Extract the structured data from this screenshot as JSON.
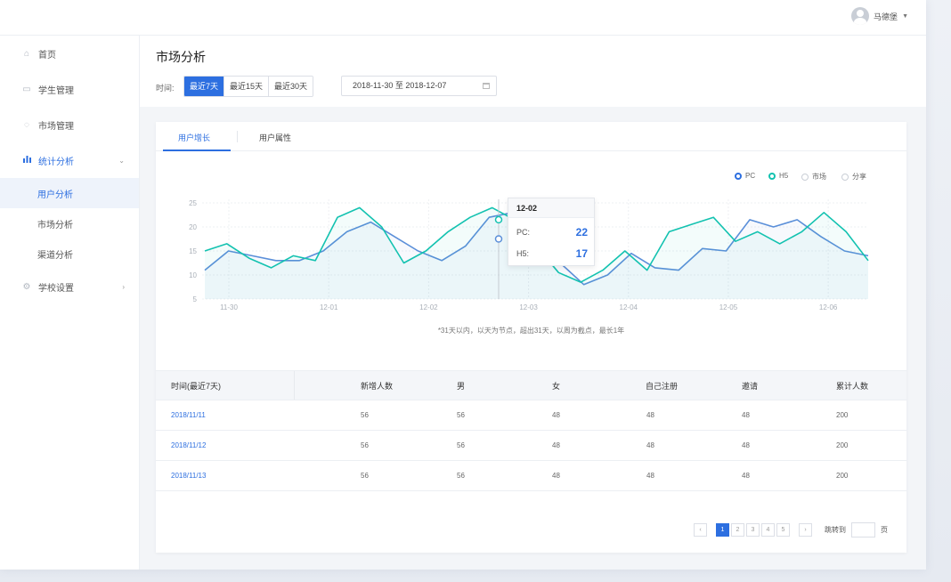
{
  "topbar": {
    "user_name": "马德堡"
  },
  "sidebar": {
    "items": [
      {
        "label": "首页",
        "icon": "home-icon"
      },
      {
        "label": "学生管理",
        "icon": "list-icon"
      },
      {
        "label": "市场管理",
        "icon": "tag-icon"
      },
      {
        "label": "统计分析",
        "icon": "bar-chart-icon"
      },
      {
        "label": "学校设置",
        "icon": "gear-icon"
      }
    ],
    "sub_items": [
      {
        "label": "用户分析"
      },
      {
        "label": "市场分析"
      },
      {
        "label": "渠道分析"
      }
    ]
  },
  "page": {
    "title": "市场分析",
    "time_label": "时间:",
    "ranges": [
      "最近7天",
      "最近15天",
      "最近30天"
    ],
    "date_range": "2018-11-30 至 2018-12-07"
  },
  "tabs": [
    "用户增长",
    "用户属性"
  ],
  "legend": [
    {
      "label": "PC",
      "color": "#2d6fe0",
      "on": true
    },
    {
      "label": "H5",
      "color": "#13c2b0",
      "on": true
    },
    {
      "label": "市场",
      "on": false
    },
    {
      "label": "分享",
      "on": false
    }
  ],
  "chart_data": {
    "type": "line",
    "x_ticks": [
      "11-30",
      "12-01",
      "12-02",
      "12-03",
      "12-04",
      "12-05",
      "12-06"
    ],
    "y_ticks": [
      5,
      10,
      15,
      20,
      25
    ],
    "ylim": [
      5,
      25
    ],
    "grid": true,
    "x": [
      0,
      0.25,
      0.5,
      0.75,
      1.0,
      1.25,
      1.5,
      1.75,
      2.0,
      2.25,
      2.5,
      2.75,
      3.0,
      3.25,
      3.5,
      3.75,
      4.0,
      4.25,
      4.5,
      4.75,
      5.0,
      5.25,
      5.5,
      5.75,
      6.0,
      6.25
    ],
    "series": [
      {
        "name": "PC",
        "color": "#5b8fd9",
        "values": [
          11,
          15,
          14,
          13,
          13,
          15,
          19,
          21,
          18,
          15,
          13,
          16,
          22,
          23,
          17.5,
          12.5,
          8,
          10,
          14.5,
          11.5,
          11,
          15.5,
          15,
          21.5,
          20,
          21.5,
          18,
          15,
          14
        ]
      },
      {
        "name": "H5",
        "color": "#13c2b0",
        "values": [
          15,
          16.5,
          13.5,
          11.5,
          14,
          13,
          22,
          24,
          20,
          12.5,
          15,
          19,
          22,
          24,
          21.5,
          16,
          10.5,
          8.5,
          11,
          15,
          11,
          19,
          20.5,
          22,
          17,
          19,
          16.5,
          19,
          23,
          19,
          13
        ]
      }
    ],
    "tooltip": {
      "label": "12-02",
      "rows": [
        {
          "name": "PC:",
          "value": "22"
        },
        {
          "name": "H5:",
          "value": "17"
        }
      ]
    }
  },
  "chart_note": "*31天以内，以天为节点，超出31天，以周为截点，最长1年",
  "table": {
    "headers": [
      "时间(最近7天)",
      "新增人数",
      "男",
      "女",
      "自己注册",
      "邀请",
      "累计人数"
    ],
    "rows": [
      [
        "2018/11/11",
        "56",
        "56",
        "48",
        "48",
        "48",
        "200"
      ],
      [
        "2018/11/12",
        "56",
        "56",
        "48",
        "48",
        "48",
        "200"
      ],
      [
        "2018/11/13",
        "56",
        "56",
        "48",
        "48",
        "48",
        "200"
      ]
    ]
  },
  "pager": {
    "prev": "‹",
    "pages": [
      "1",
      "2",
      "3",
      "4",
      "5"
    ],
    "next": "›",
    "jump_label": "跳转到",
    "jump_unit": "页"
  }
}
